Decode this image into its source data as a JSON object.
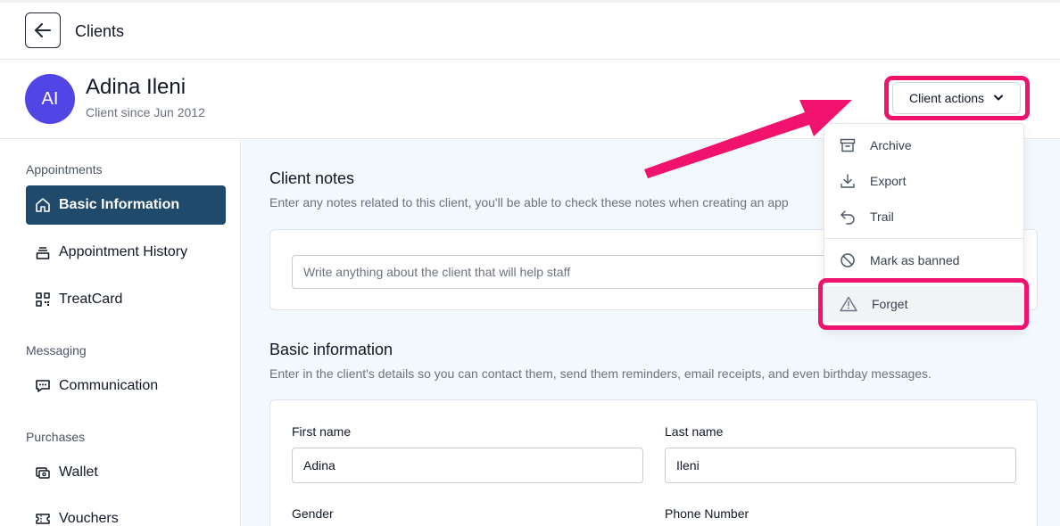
{
  "topbar": {
    "title": "Clients",
    "back_icon": "arrow-left-icon"
  },
  "client": {
    "initials": "AI",
    "name": "Adina Ileni",
    "since": "Client since Jun 2012"
  },
  "actions": {
    "label": "Client actions",
    "icon": "chevron-down-icon"
  },
  "sidebar": {
    "sections": [
      {
        "title": "Appointments",
        "items": [
          {
            "label": "Basic Information",
            "icon": "home-icon",
            "active": true
          },
          {
            "label": "Appointment History",
            "icon": "appointment-history-icon"
          },
          {
            "label": "TreatCard",
            "icon": "qr-code-icon"
          }
        ]
      },
      {
        "title": "Messaging",
        "items": [
          {
            "label": "Communication",
            "icon": "chat-icon"
          }
        ]
      },
      {
        "title": "Purchases",
        "items": [
          {
            "label": "Wallet",
            "icon": "wallet-icon"
          },
          {
            "label": "Vouchers",
            "icon": "voucher-icon"
          }
        ]
      }
    ]
  },
  "notes": {
    "title": "Client notes",
    "description": "Enter any notes related to this client, you'll be able to check these notes when creating an app",
    "placeholder": "Write anything about the client that will help staff"
  },
  "basic_info": {
    "title": "Basic information",
    "description": "Enter in the client's details so you can contact them, send them reminders, email receipts, and even birthday messages.",
    "first_name_label": "First name",
    "first_name_value": "Adina",
    "last_name_label": "Last name",
    "last_name_value": "Ileni",
    "gender_label": "Gender",
    "phone_label": "Phone Number"
  },
  "menu": {
    "items": [
      {
        "label": "Archive",
        "icon": "archive-icon"
      },
      {
        "label": "Export",
        "icon": "download-icon"
      },
      {
        "label": "Trail",
        "icon": "undo-icon"
      },
      {
        "label": "Mark as banned",
        "icon": "ban-icon"
      },
      {
        "label": "Forget",
        "icon": "warning-icon",
        "hovered": true
      }
    ]
  },
  "colors": {
    "accent": "#1f4a6b",
    "avatar": "#5145e5",
    "highlight": "#f0126c",
    "main_bg": "#f3f8fd"
  }
}
